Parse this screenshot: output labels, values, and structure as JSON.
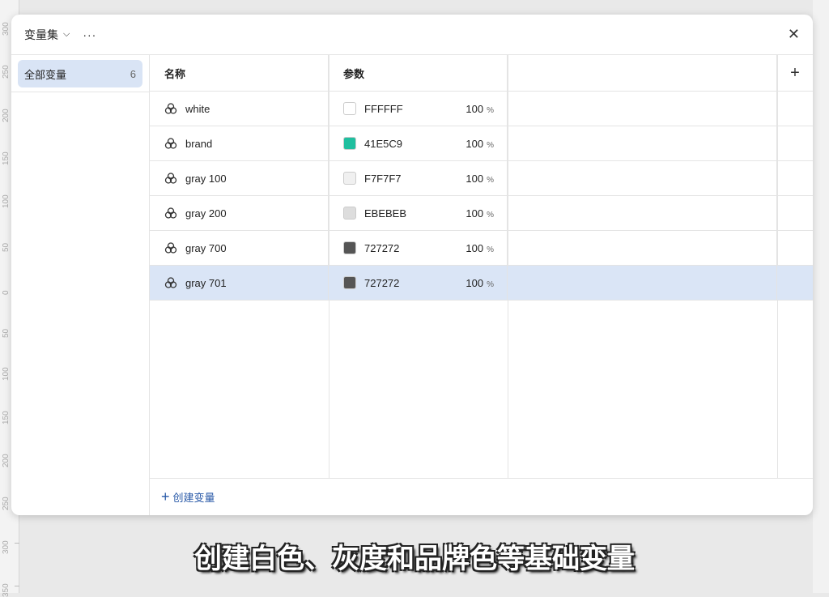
{
  "ruler": {
    "labels": [
      "300",
      "250",
      "200",
      "150",
      "100",
      "50",
      "0",
      "50",
      "100",
      "150",
      "200",
      "250",
      "300",
      "350"
    ]
  },
  "dialog": {
    "title": "变量集",
    "more": "···",
    "close": "✕",
    "sidebar": {
      "item": {
        "label": "全部变量",
        "count": "6"
      }
    },
    "table": {
      "headers": {
        "name": "名称",
        "param": "参数",
        "add": "+"
      },
      "rows": [
        {
          "name": "white",
          "hex": "FFFFFF",
          "color": "#FFFFFF",
          "opacity": "100",
          "unit": "%"
        },
        {
          "name": "brand",
          "hex": "41E5C9",
          "color": "#1fbf9f",
          "opacity": "100",
          "unit": "%"
        },
        {
          "name": "gray 100",
          "hex": "F7F7F7",
          "color": "#F0F0F0",
          "opacity": "100",
          "unit": "%"
        },
        {
          "name": "gray 200",
          "hex": "EBEBEB",
          "color": "#DDDDDD",
          "opacity": "100",
          "unit": "%"
        },
        {
          "name": "gray 700",
          "hex": "727272",
          "color": "#555555",
          "opacity": "100",
          "unit": "%"
        },
        {
          "name": "gray 701",
          "hex": "727272",
          "color": "#555555",
          "opacity": "100",
          "unit": "%"
        }
      ]
    },
    "footer": {
      "plus": "+",
      "create_label": "创建变量"
    }
  },
  "caption": "创建白色、灰度和品牌色等基础变量"
}
